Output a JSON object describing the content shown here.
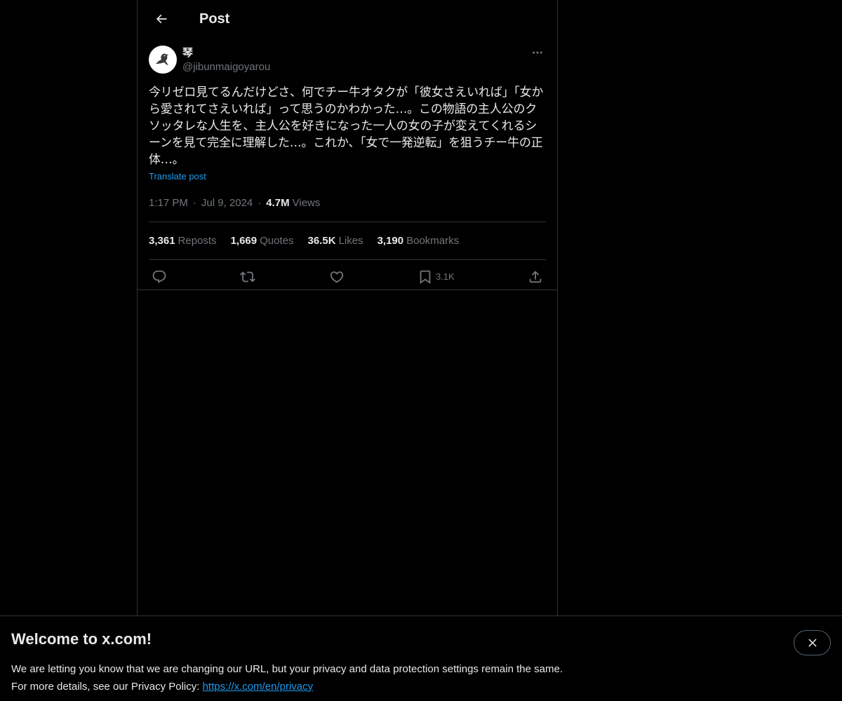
{
  "header": {
    "title": "Post",
    "back_icon": "arrow-left-icon"
  },
  "post": {
    "author": {
      "display_name": "琴",
      "handle": "@jibunmaigoyarou",
      "avatar_icon": "crow-avatar-icon"
    },
    "more_icon": "more-dots-icon",
    "text": "今リゼロ見てるんだけどさ、何でチー牛オタクが「彼女さえいれば」「女から愛されてさえいれば」って思うのかわかった…。この物語の主人公のクソッタレな人生を、主人公を好きになった一人の女の子が変えてくれるシーンを見て完全に理解した…。これか、「女で一発逆転」を狙うチー牛の正体…。",
    "translate_label": "Translate post",
    "time": "1:17 PM",
    "date": "Jul 9, 2024",
    "separator": "·",
    "views_count": "4.7M",
    "views_label": "Views",
    "stats": [
      {
        "count": "3,361",
        "label": "Reposts"
      },
      {
        "count": "1,669",
        "label": "Quotes"
      },
      {
        "count": "36.5K",
        "label": "Likes"
      },
      {
        "count": "3,190",
        "label": "Bookmarks"
      }
    ],
    "actions": {
      "reply_icon": "reply-icon",
      "repost_icon": "repost-icon",
      "like_icon": "heart-icon",
      "bookmark_icon": "bookmark-icon",
      "bookmark_count": "3.1K",
      "share_icon": "share-icon"
    }
  },
  "banner": {
    "title": "Welcome to x.com!",
    "line1": "We are letting you know that we are changing our URL, but your privacy and data protection settings remain the same.",
    "line2_prefix": "For more details, see our Privacy Policy: ",
    "link_text": "https://x.com/en/privacy",
    "close_icon": "close-icon"
  },
  "colors": {
    "background": "#000000",
    "text_primary": "#e7e9ea",
    "text_secondary": "#71767b",
    "accent": "#1d9bf0",
    "border": "#2f3336"
  }
}
